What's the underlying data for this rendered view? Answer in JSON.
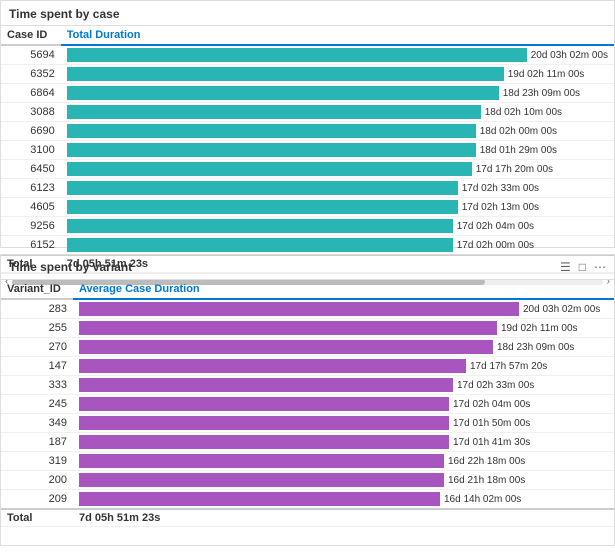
{
  "section1": {
    "title": "Time spent by case",
    "col1": "Case ID",
    "col2": "Total Duration",
    "rows": [
      {
        "id": "5694",
        "duration": "20d 03h 02m 00s",
        "pct": 100
      },
      {
        "id": "6352",
        "duration": "19d 02h 11m 00s",
        "pct": 95
      },
      {
        "id": "6864",
        "duration": "18d 23h 09m 00s",
        "pct": 94
      },
      {
        "id": "3088",
        "duration": "18d 02h 10m 00s",
        "pct": 90
      },
      {
        "id": "6690",
        "duration": "18d 02h 00m 00s",
        "pct": 89
      },
      {
        "id": "3100",
        "duration": "18d 01h 29m 00s",
        "pct": 89
      },
      {
        "id": "6450",
        "duration": "17d 17h 20m 00s",
        "pct": 88
      },
      {
        "id": "6123",
        "duration": "17d 02h 33m 00s",
        "pct": 85
      },
      {
        "id": "4605",
        "duration": "17d 02h 13m 00s",
        "pct": 85
      },
      {
        "id": "9256",
        "duration": "17d 02h 04m 00s",
        "pct": 84
      },
      {
        "id": "6152",
        "duration": "17d 02h 00m 00s",
        "pct": 84
      }
    ],
    "total_label": "Total",
    "total_value": "7d 05h 51m 23s"
  },
  "section2": {
    "title": "Time spent by variant",
    "col1": "Variant_ID",
    "col2": "Average Case Duration",
    "rows": [
      {
        "id": "283",
        "duration": "20d 03h 02m 00s",
        "pct": 100
      },
      {
        "id": "255",
        "duration": "19d 02h 11m 00s",
        "pct": 95
      },
      {
        "id": "270",
        "duration": "18d 23h 09m 00s",
        "pct": 94
      },
      {
        "id": "147",
        "duration": "17d 17h 57m 20s",
        "pct": 88
      },
      {
        "id": "333",
        "duration": "17d 02h 33m 00s",
        "pct": 85
      },
      {
        "id": "245",
        "duration": "17d 02h 04m 00s",
        "pct": 84
      },
      {
        "id": "349",
        "duration": "17d 01h 50m 00s",
        "pct": 84
      },
      {
        "id": "187",
        "duration": "17d 01h 41m 30s",
        "pct": 84
      },
      {
        "id": "319",
        "duration": "16d 22h 18m 00s",
        "pct": 83
      },
      {
        "id": "200",
        "duration": "16d 21h 18m 00s",
        "pct": 83
      },
      {
        "id": "209",
        "duration": "16d 14h 02m 00s",
        "pct": 82
      }
    ],
    "total_label": "Total",
    "total_value": "7d 05h 51m 23s",
    "icons": [
      "≡",
      "⊡",
      "···"
    ]
  }
}
